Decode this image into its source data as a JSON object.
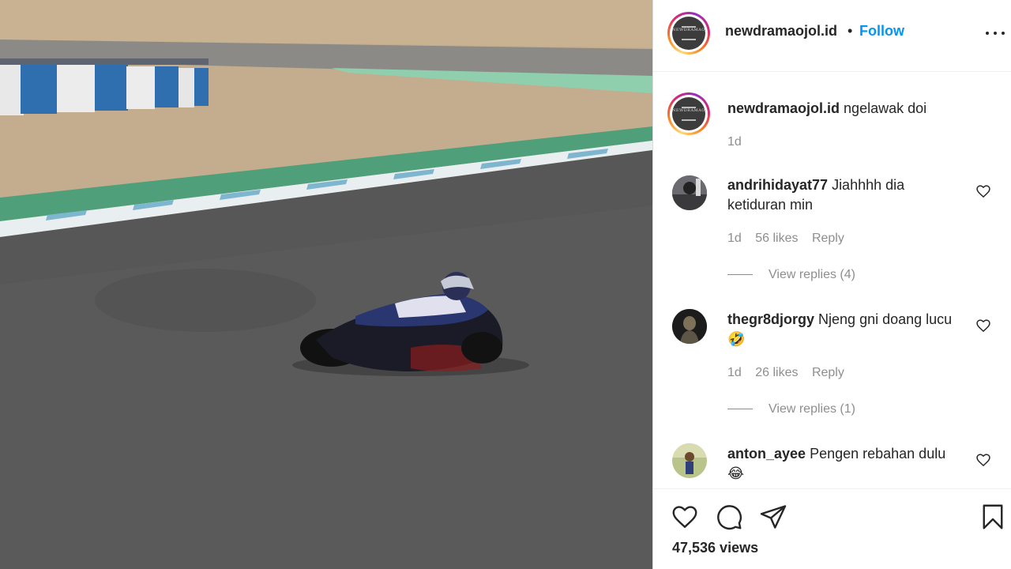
{
  "post": {
    "username": "newdramaojol.id",
    "follow_label": "Follow",
    "separator": "•",
    "avatar_logo": "NEWDRAMAOJOL"
  },
  "caption": {
    "username": "newdramaojol.id",
    "text": "ngelawak doi",
    "time": "1d"
  },
  "comments": [
    {
      "username": "andrihidayat77",
      "text": "Jiahhhh dia ketiduran min",
      "time": "1d",
      "likes": "56 likes",
      "reply_label": "Reply",
      "view_replies": "View replies (4)"
    },
    {
      "username": "thegr8djorgy",
      "text": "Njeng gni doang lucu 🤣",
      "time": "1d",
      "likes": "26 likes",
      "reply_label": "Reply",
      "view_replies": "View replies (1)"
    },
    {
      "username": "anton_ayee",
      "text": "Pengen rebahan dulu 😂"
    }
  ],
  "actions": {
    "views": "47,536 views",
    "icons": [
      "heart-icon",
      "comment-icon",
      "share-icon",
      "bookmark-icon"
    ]
  },
  "colors": {
    "link_blue": "#0095f6",
    "text": "#262626",
    "muted": "#8e8e8e"
  }
}
